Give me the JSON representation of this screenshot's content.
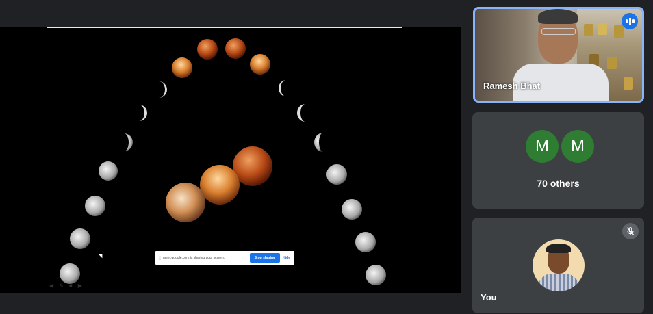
{
  "presentation": {
    "banner": {
      "text": "meet.google.com is sharing your screen.",
      "stop_label": "Stop sharing",
      "hide_label": "Hide"
    }
  },
  "participants": {
    "speaker": {
      "name": "Ramesh Bhat",
      "speaking": true
    },
    "others": {
      "initials": [
        "M",
        "M"
      ],
      "label": "70 others",
      "avatar_color": "#2e7d32"
    },
    "self": {
      "label": "You",
      "muted": true
    }
  },
  "colors": {
    "background": "#202124",
    "tile": "#3c4043",
    "active_border": "#8ab4f8",
    "accent": "#1a73e8"
  },
  "icons": {
    "speaking": "audio-bars-icon",
    "mic": "mic-off-icon"
  }
}
